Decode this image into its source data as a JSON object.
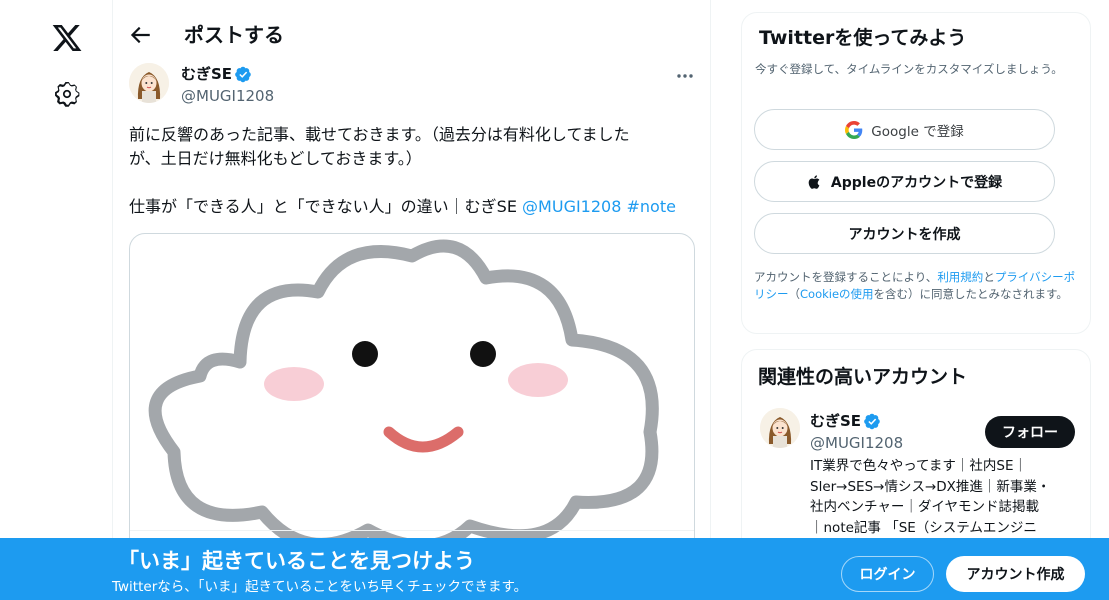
{
  "nav": {
    "logo_icon": "x-logo-icon",
    "settings_icon": "gear-icon"
  },
  "header": {
    "title": "ポストする",
    "back_icon": "arrow-left-icon"
  },
  "tweet": {
    "author": {
      "name": "むぎSE",
      "handle": "@MUGI1208",
      "verified": true
    },
    "more_icon": "ellipsis-icon",
    "line1": "前に反響のあった記事、載せておきます。（過去分は有料化してました",
    "line2": "が、土日だけ無料化もどしておきます。）",
    "line3_text": "仕事が「できる人」と「できない人」の違い｜むぎSE ",
    "mention": "@MUGI1208",
    "hashtag": "#note"
  },
  "signup": {
    "title": "Twitterを使ってみよう",
    "subtitle": "今すぐ登録して、タイムラインをカスタマイズしましょう。",
    "google_prefix": "Google",
    "google_suffix": " で登録",
    "apple_label": "Appleのアカウントで登録",
    "create_label": "アカウントを作成",
    "legal_1": "アカウントを登録することにより、",
    "legal_terms": "利用規約",
    "legal_and": "と",
    "legal_privacy": "プライバシーポリシー",
    "legal_2": "（",
    "legal_cookie": "Cookieの使用",
    "legal_3": "を含む）に同意したとみなされます。"
  },
  "related": {
    "title": "関連性の高いアカウント",
    "name": "むぎSE",
    "handle": "@MUGI1208",
    "follow_label": "フォロー",
    "bio": [
      "IT業界で色々やってます｜社内SE｜",
      "Sler→SES→情シス→DX推進｜新事業・",
      "社内ベンチャー｜ダイヤモンド誌掲載",
      "｜note記事 「SE（システムエンジニ"
    ]
  },
  "bottom": {
    "title": "「いま」起きていることを見つけよう",
    "subtitle": "Twitterなら、「いま」起きていることをいち早くチェックできます。",
    "login_label": "ログイン",
    "signup_label": "アカウント作成"
  },
  "colors": {
    "accent": "#1d9bf0",
    "text": "#0f1419",
    "muted": "#536471",
    "border": "#cfd9de"
  }
}
